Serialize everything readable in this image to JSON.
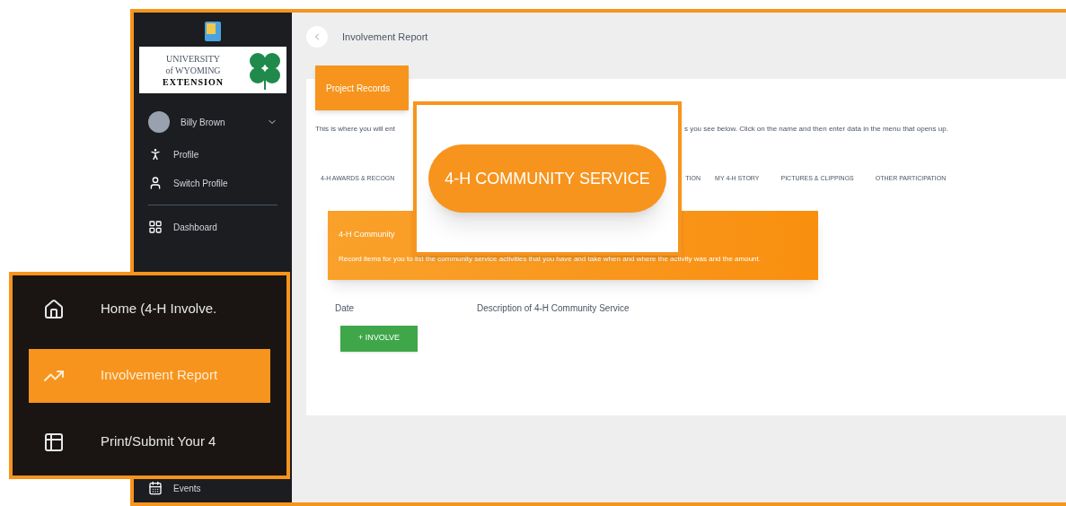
{
  "sidebar": {
    "logo_lines": [
      "UNIVERSITY",
      "of WYOMING",
      "EXTENSION"
    ],
    "user": "Billy Brown",
    "items": [
      {
        "label": "Profile"
      },
      {
        "label": "Switch Profile"
      },
      {
        "label": "Dashboard"
      }
    ],
    "bottom_items": [
      {
        "label": "Events"
      }
    ]
  },
  "header": {
    "title": "Involvement Report"
  },
  "panel": {
    "badge": "Project Records",
    "intro_start": "This is where you will ent",
    "intro_end": "s you see below. Click on the name and then enter data in the menu that opens up.",
    "tabs": [
      "4-H AWARDS & RECOGN",
      "TION",
      "MY 4-H STORY",
      "PICTURES & CLIPPINGS",
      "OTHER PARTICIPATION"
    ]
  },
  "card": {
    "title": "4-H Community",
    "description": "Record items for you to list the community service activities that you have and take when and where the activity was and the amount."
  },
  "table": {
    "columns": [
      "Date",
      "Description of 4-H Community Service"
    ]
  },
  "add_button": "+ INVOLVE",
  "callouts": {
    "tab": "4-H COMMUNITY SERVICE",
    "menu": [
      {
        "label": "Home (4-H Involve.",
        "selected": false
      },
      {
        "label": "Involvement Report",
        "selected": true
      },
      {
        "label": "Print/Submit Your 4",
        "selected": false
      }
    ]
  }
}
